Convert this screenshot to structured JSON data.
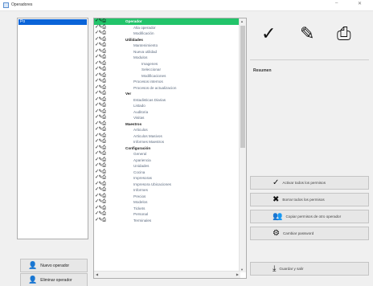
{
  "window": {
    "title": "Operadores",
    "minimize_glyph": "–",
    "close_glyph": "✕"
  },
  "left_list": {
    "selected_item": "Po"
  },
  "left_buttons": [
    {
      "label": "Nuevo operador",
      "icon": "user-add-icon"
    },
    {
      "label": "Eliminar operador",
      "icon": "user-remove-icon"
    }
  ],
  "tree": {
    "items": [
      {
        "label": "Operador",
        "level": 0,
        "type": "group",
        "highlighted": true
      },
      {
        "label": "Alta operador",
        "level": 1,
        "type": "item"
      },
      {
        "label": "Modificación",
        "level": 1,
        "type": "item"
      },
      {
        "label": "Utilidades",
        "level": 0,
        "type": "group"
      },
      {
        "label": "Mantenimiento",
        "level": 1,
        "type": "item"
      },
      {
        "label": "Nueva utilidad",
        "level": 1,
        "type": "item"
      },
      {
        "label": "Modulos",
        "level": 1,
        "type": "item"
      },
      {
        "label": "Imagenes",
        "level": 2,
        "type": "item"
      },
      {
        "label": "Seleccionar",
        "level": 2,
        "type": "item"
      },
      {
        "label": "Modificaciones",
        "level": 2,
        "type": "item"
      },
      {
        "label": "Procesos internos",
        "level": 1,
        "type": "item"
      },
      {
        "label": "Procesos de actualizacion",
        "level": 1,
        "type": "item"
      },
      {
        "label": "Ver",
        "level": 0,
        "type": "group"
      },
      {
        "label": "Estadisticas Diarias",
        "level": 1,
        "type": "item"
      },
      {
        "label": "Listado",
        "level": 1,
        "type": "item"
      },
      {
        "label": "Auditoria",
        "level": 1,
        "type": "item"
      },
      {
        "label": "Visitas",
        "level": 1,
        "type": "item"
      },
      {
        "label": "Maestros",
        "level": 0,
        "type": "group"
      },
      {
        "label": "Articulos",
        "level": 1,
        "type": "item"
      },
      {
        "label": "Articulos Masivos",
        "level": 1,
        "type": "item"
      },
      {
        "label": "Informes Maestros",
        "level": 1,
        "type": "item"
      },
      {
        "label": "Configuración",
        "level": 0,
        "type": "group"
      },
      {
        "label": "General",
        "level": 1,
        "type": "item"
      },
      {
        "label": "Apariencia",
        "level": 1,
        "type": "item"
      },
      {
        "label": "Unidades",
        "level": 1,
        "type": "item"
      },
      {
        "label": "Cocina",
        "level": 1,
        "type": "item"
      },
      {
        "label": "Impresoras",
        "level": 1,
        "type": "item"
      },
      {
        "label": "Impresora Ubicaciones",
        "level": 1,
        "type": "item"
      },
      {
        "label": "Informes",
        "level": 1,
        "type": "item"
      },
      {
        "label": "Precios",
        "level": 1,
        "type": "item"
      },
      {
        "label": "Modelos",
        "level": 1,
        "type": "item"
      },
      {
        "label": "Tickets",
        "level": 1,
        "type": "item"
      },
      {
        "label": "Personal",
        "level": 1,
        "type": "item"
      },
      {
        "label": "Terminales",
        "level": 1,
        "type": "item"
      }
    ],
    "row_icons": [
      "check-icon",
      "pencil-icon",
      "printer-icon"
    ]
  },
  "toolbar": {
    "icons": [
      "check-circle-icon",
      "pencil-icon",
      "printer-icon"
    ]
  },
  "results": {
    "label": "Resumen"
  },
  "right_buttons": [
    {
      "label": "Activar todos los permisos",
      "icon": "check-circle-icon"
    },
    {
      "label": "Borrar todos los permisos",
      "icon": "x-circle-icon"
    },
    {
      "label": "Copiar permisos de otro operador",
      "icon": "users-icon"
    },
    {
      "label": "Cambiar password",
      "icon": "key-icon"
    },
    {
      "label": "Guardar y salir",
      "icon": "save-icon"
    }
  ]
}
